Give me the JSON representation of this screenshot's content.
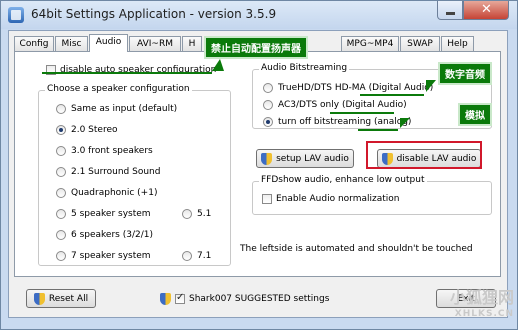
{
  "window": {
    "title": "64bit Settings Application - version 3.5.9"
  },
  "tabs": [
    {
      "label": "Config"
    },
    {
      "label": "Misc"
    },
    {
      "label": "Audio"
    },
    {
      "label": "AVI~RM"
    },
    {
      "label": "H"
    },
    {
      "label": "MPG~MP4"
    },
    {
      "label": "SWAP"
    },
    {
      "label": "Help"
    }
  ],
  "audio": {
    "disable_auto_speaker": "disable auto speaker configuration",
    "speaker_group_title": "Choose a speaker configuration",
    "speaker_options": [
      {
        "label": "Same as input (default)"
      },
      {
        "label": "2.0 Stereo"
      },
      {
        "label": "3.0 front speakers"
      },
      {
        "label": "2.1 Surround Sound"
      },
      {
        "label": "Quadraphonic (+1)"
      },
      {
        "label": "5 speaker system"
      },
      {
        "label": "6 speakers (3/2/1)"
      },
      {
        "label": "7 speaker system"
      }
    ],
    "speaker_51": "5.1",
    "speaker_71": "7.1",
    "bitstream_group_title": "Audio Bitstreaming",
    "bitstream_options": [
      {
        "label": "TrueHD/DTS HD-MA (Digital Audio)"
      },
      {
        "label": "AC3/DTS only (Digital Audio)"
      },
      {
        "label": "turn off bitstreaming (analog)"
      }
    ],
    "setup_lav_label": "setup LAV audio",
    "disable_lav_label": "disable LAV audio",
    "ffd_group_title": "FFDshow audio, enhance low output",
    "enable_normalization": "Enable Audio normalization",
    "note": "The leftside is automated and shouldn't be touched"
  },
  "footer": {
    "reset_label": "Reset All",
    "suggested_label": "Shark007 SUGGESTED settings",
    "exit_label": "Exit"
  },
  "annotations": {
    "disable_auto_cn": "禁止自动配置扬声器",
    "digital_cn": "数字音频",
    "analog_cn": "模拟"
  },
  "watermark": {
    "line1": "小狐狸网",
    "line2": "XHLKS.CN"
  },
  "colors": {
    "annotation": "#0b7a0b",
    "highlight": "#d1182b"
  }
}
